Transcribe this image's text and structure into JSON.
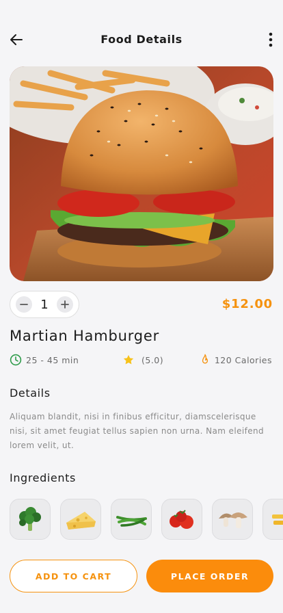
{
  "header": {
    "title": "Food Details",
    "back_icon": "arrow-left-icon",
    "more_icon": "more-vertical-icon"
  },
  "hero": {
    "image": "burger-photo"
  },
  "quantity": {
    "value": "1",
    "minus_icon": "minus-icon",
    "plus_icon": "plus-icon"
  },
  "price": "$12.00",
  "name": "Martian Hamburger",
  "meta": {
    "time": "25 - 45 min",
    "rating": "(5.0)",
    "calories": "120 Calories"
  },
  "details": {
    "title": "Details",
    "text": "Aliquam blandit, nisi in finibus efficitur, diamscelerisque nisi, sit amet feugiat tellus sapien non urna. Nam eleifend lorem velit, ut."
  },
  "ingredients": {
    "title": "Ingredients",
    "items": [
      "broccoli",
      "cheese",
      "green-beans",
      "tomatoes",
      "mushrooms",
      "pasta"
    ]
  },
  "actions": {
    "add_to_cart": "ADD TO CART",
    "place_order": "PLACE ORDER"
  },
  "colors": {
    "accent": "#f5920f",
    "background": "#f5f5f7",
    "time_icon": "#2e9b4a",
    "star": "#f7c21a"
  }
}
